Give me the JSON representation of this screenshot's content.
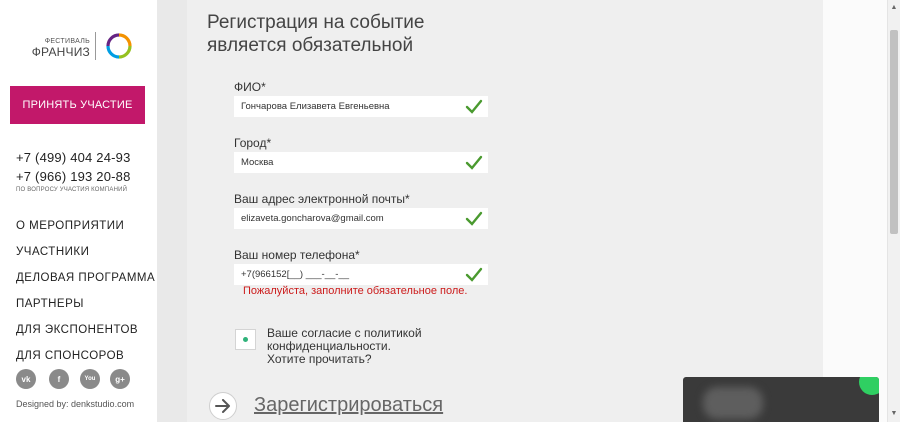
{
  "sidebar": {
    "logo": {
      "small_text": "ФЕСТИВАЛЬ",
      "big_text": "ФРАНЧИЗ",
      "ring_colors": [
        "#e6007e",
        "#f39200",
        "#95c11f",
        "#009ee3",
        "#662483"
      ]
    },
    "cta_label": "ПРИНЯТЬ УЧАСТИЕ",
    "phones": [
      "+7 (499) 404 24-93",
      "+7 (966) 193 20-88"
    ],
    "phone_note": "ПО ВОПРОСУ УЧАСТИЯ КОМПАНИЙ",
    "nav": [
      {
        "label": "О МЕРОПРИЯТИИ"
      },
      {
        "label": "УЧАСТНИКИ"
      },
      {
        "label": "ДЕЛОВАЯ ПРОГРАММА"
      },
      {
        "label": "ПАРТНЕРЫ"
      },
      {
        "label": "ДЛЯ ЭКСПОНЕНТОВ"
      },
      {
        "label": "ДЛЯ СПОНСОРОВ"
      }
    ],
    "social": [
      {
        "icon": "vk-icon",
        "label": "vk"
      },
      {
        "icon": "facebook-icon",
        "label": "f"
      },
      {
        "icon": "youtube-icon",
        "label": "You"
      },
      {
        "icon": "google-plus-icon",
        "label": "g+"
      }
    ],
    "designed_by": "Designed by: denkstudio.com"
  },
  "form": {
    "title_line1": "Регистрация на событие",
    "title_line2": "является обязательной",
    "fields": [
      {
        "label": "ФИО*",
        "value": "Гончарова Елизавета Евгеньевна"
      },
      {
        "label": "Город*",
        "value": "Москва"
      },
      {
        "label": "Ваш адрес электронной почты*",
        "value": "elizaveta.goncharova@gmail.com"
      },
      {
        "label": "Ваш номер телефона*",
        "value": "+7(966152[__) ___-__-__"
      }
    ],
    "error_message": "Пожалуйста, заполните обязательное поле.",
    "consent": {
      "line1": "Ваше согласие с политикой",
      "line2": "конфиденциальности.",
      "line3": "Хотите прочитать?"
    },
    "submit_label": "Зарегистрироваться"
  },
  "colors": {
    "brand_magenta": "#c2186a",
    "check_green": "#4a9a2f",
    "error_red": "#cc1b1b",
    "consent_dot": "#2fb27a"
  }
}
